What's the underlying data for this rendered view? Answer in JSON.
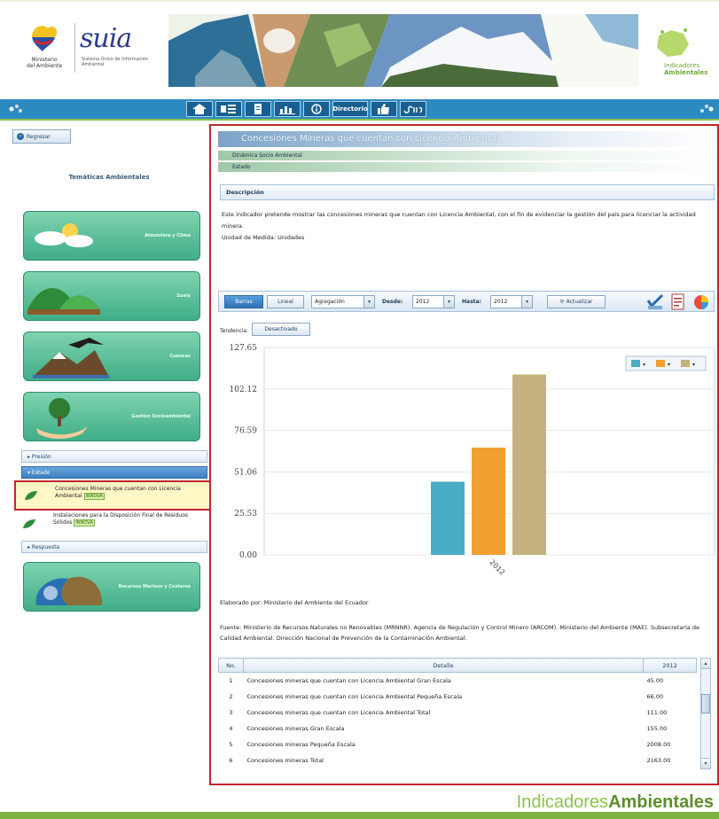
{
  "header": {
    "ministry_lines": [
      "Ministerio",
      "del Ambiente"
    ],
    "suia_word": "suia",
    "suia_subtitle": "Sistema Único de Información Ambiental",
    "brand_right": [
      "Indicadores",
      "Ambientales"
    ]
  },
  "nav": {
    "buttons": [
      {
        "icon": "home-icon"
      },
      {
        "icon": "tools-icon"
      },
      {
        "icon": "document-icon"
      },
      {
        "icon": "chart-bars-icon"
      },
      {
        "icon": "info-icon"
      },
      {
        "label": "Directorio"
      },
      {
        "icon": "thumbs-up-icon"
      },
      {
        "icon": "suia-icon"
      }
    ]
  },
  "sidebar": {
    "back_label": "Regresar",
    "heading": "Temáticas Ambientales",
    "themes": [
      {
        "label": "Atmósfera y Clima"
      },
      {
        "label": "Suelo"
      },
      {
        "label": "Cuencas"
      },
      {
        "label": "Gestión Socioambiental"
      },
      {
        "label": "Recursos Marinos y Costeros"
      }
    ],
    "categories": {
      "presion": "Presión",
      "estado": "Estado",
      "respuesta": "Respuesta"
    },
    "indicators": [
      {
        "text": "Concesiones Mineras que cuentan con Licencia Ambiental",
        "badge": "INNOVA"
      },
      {
        "text": "Instalaciones para la Disposición Final de Residuos Sólidos",
        "badge": "INNOVA"
      }
    ]
  },
  "main": {
    "title": "Concesiones Mineras que cuentan con Licencia Ambiental",
    "subtitle_1": "Dinámica Socio Ambiental",
    "subtitle_2": "Estado",
    "description_head": "Descripción",
    "description_text": "Este indicador pretende mostrar las concesiones mineras que cuentan con Licencia Ambiental, con el fin de evidenciar la gestión del país para licenciar la actividad minera.",
    "unit": "Unidad de Medida: Unidades",
    "toolbar": {
      "barras": "Barras",
      "lineal": "Lineal",
      "agregacion": "Agregación",
      "desde_label": "Desde:",
      "desde_value": "2012",
      "hasta_label": "Hasta:",
      "hasta_value": "2012",
      "actualizar": "Actualizar"
    },
    "tendencia_label": "Tendencia:",
    "desactivado": "Desactivado",
    "elaborado": "Elaborado por: Ministerio del Ambiente del Ecuador",
    "fuente": "Fuente: Ministerio de Recursos Naturales no Renovables (MRNNR). Agencia de Regulación y Control Minero (ARCOM). Ministerio del Ambiente (MAE). Subsecretaría de Calidad Ambiental. Dirección Nacional de Prevención de la Contaminación Ambiental.",
    "table": {
      "headers": [
        "No.",
        "Detalle",
        "2012"
      ],
      "rows": [
        [
          "1",
          "Concesiones mineras que cuentan con Licencia Ambiental Gran Escala",
          "45.00"
        ],
        [
          "2",
          "Concesiones mineras que cuentan con Licencia Ambiental Pequeña Escala",
          "66.00"
        ],
        [
          "3",
          "Concesiones mineras que cuentan con Licencia Ambiental Total",
          "111.00"
        ],
        [
          "4",
          "Concesiones mineras Gran Escala",
          "155.00"
        ],
        [
          "5",
          "Concesiones mineras Pequeña Escala",
          "2008.00"
        ],
        [
          "6",
          "Concesiones mineras Total",
          "2163.00"
        ]
      ]
    }
  },
  "chart_data": {
    "type": "bar",
    "categories": [
      "2012"
    ],
    "series": [
      {
        "values": [
          45
        ]
      },
      {
        "values": [
          66
        ]
      },
      {
        "values": [
          111
        ]
      }
    ],
    "colors": [
      "#4bacc6",
      "#f0a030",
      "#c4b27e"
    ],
    "yticks": [
      "0.00",
      "25.53",
      "51.06",
      "76.59",
      "102.12",
      "127.65"
    ],
    "ylim": [
      0,
      127.65
    ],
    "grid": true,
    "legend": "top-right"
  },
  "footer": {
    "brand_light": "Indicadores",
    "brand_bold": "Ambientales"
  }
}
